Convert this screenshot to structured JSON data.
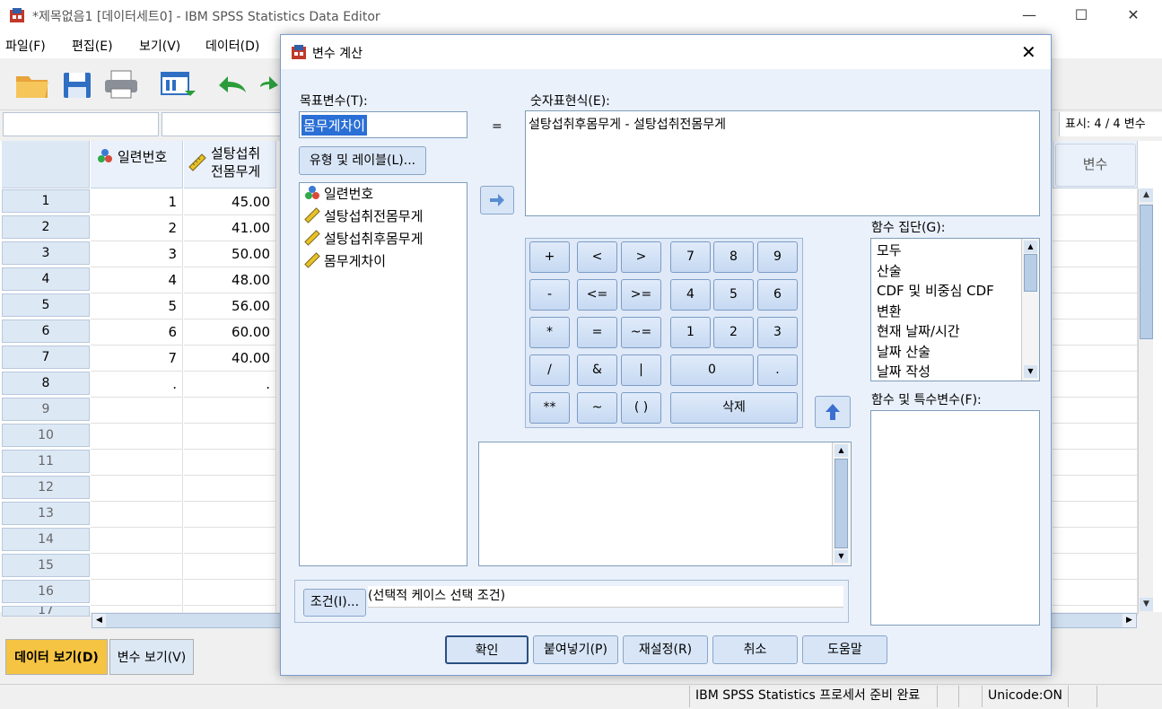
{
  "window": {
    "title": "*제목없음1 [데이터세트0] - IBM SPSS Statistics Data Editor",
    "controls": {
      "minimize": "—",
      "maximize": "☐",
      "close": "✕"
    }
  },
  "menus": [
    "파일(F)",
    "편집(E)",
    "보기(V)",
    "데이터(D)"
  ],
  "toolbar": {
    "display_count": "표시: 4 / 4 변수"
  },
  "grid": {
    "columns": [
      "일련번호",
      "설탕섭취\n전몸무게"
    ],
    "right_column": "변수",
    "rows": [
      {
        "num": "1",
        "c1": "1",
        "c2": "45.00"
      },
      {
        "num": "2",
        "c1": "2",
        "c2": "41.00"
      },
      {
        "num": "3",
        "c1": "3",
        "c2": "50.00"
      },
      {
        "num": "4",
        "c1": "4",
        "c2": "48.00"
      },
      {
        "num": "5",
        "c1": "5",
        "c2": "56.00"
      },
      {
        "num": "6",
        "c1": "6",
        "c2": "60.00"
      },
      {
        "num": "7",
        "c1": "7",
        "c2": "40.00"
      },
      {
        "num": "8",
        "c1": ".",
        "c2": "."
      },
      {
        "num": "9",
        "c1": "",
        "c2": ""
      },
      {
        "num": "10",
        "c1": "",
        "c2": ""
      },
      {
        "num": "11",
        "c1": "",
        "c2": ""
      },
      {
        "num": "12",
        "c1": "",
        "c2": ""
      },
      {
        "num": "13",
        "c1": "",
        "c2": ""
      },
      {
        "num": "14",
        "c1": "",
        "c2": ""
      },
      {
        "num": "15",
        "c1": "",
        "c2": ""
      },
      {
        "num": "16",
        "c1": "",
        "c2": ""
      },
      {
        "num": "17",
        "c1": "",
        "c2": ""
      }
    ]
  },
  "tabs": {
    "data_view": "데이터 보기(D)",
    "variable_view": "변수 보기(V)"
  },
  "status": {
    "processor": "IBM SPSS Statistics 프로세서 준비 완료",
    "unicode": "Unicode:ON"
  },
  "dialog": {
    "title": "변수 계산",
    "target_label": "목표변수(T):",
    "target_value": "몸무게차이",
    "type_label_button": "유형 및 레이블(L)...",
    "equals": "=",
    "expression_label": "숫자표현식(E):",
    "expression_value": "설탕섭취후몸무게 - 설탕섭취전몸무게",
    "variables": [
      "일련번호",
      "설탕섭취전몸무게",
      "설탕섭취후몸무게",
      "몸무게차이"
    ],
    "keypad": {
      "row1": [
        "+",
        "<",
        ">",
        "7",
        "8",
        "9"
      ],
      "row2": [
        "-",
        "<=",
        ">=",
        "4",
        "5",
        "6"
      ],
      "row3": [
        "*",
        "=",
        "~=",
        "1",
        "2",
        "3"
      ],
      "row4": [
        "/",
        "&",
        "|",
        "0",
        "."
      ],
      "row5": [
        "**",
        "~",
        "( )",
        "삭제"
      ]
    },
    "function_group_label": "함수 집단(G):",
    "function_groups": [
      "모두",
      "산술",
      "CDF 및 비중심 CDF",
      "변환",
      "현재 날짜/시간",
      "날짜 산술",
      "날짜 작성"
    ],
    "functions_label": "함수 및 특수변수(F):",
    "condition_button": "조건(I)...",
    "condition_text": "(선택적 케이스 선택 조건)",
    "buttons": {
      "ok": "확인",
      "paste": "붙여넣기(P)",
      "reset": "재설정(R)",
      "cancel": "취소",
      "help": "도움말"
    }
  }
}
